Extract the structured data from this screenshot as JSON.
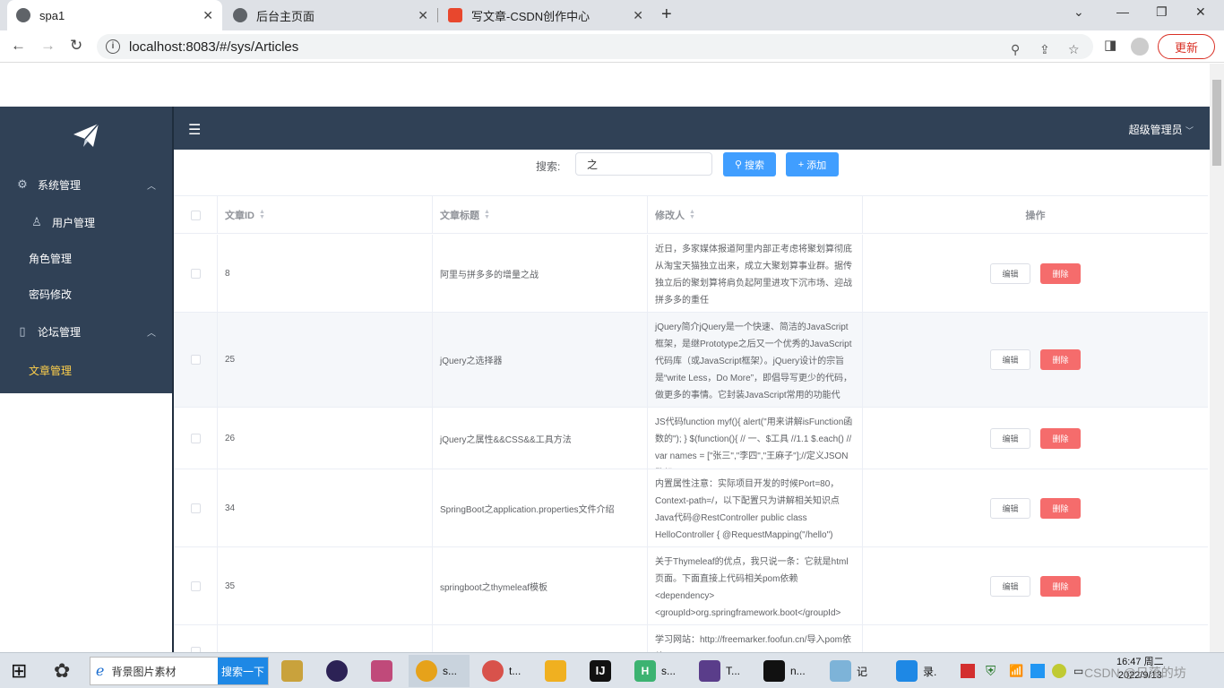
{
  "browser": {
    "tabs": [
      {
        "title": "spa1",
        "active": true
      },
      {
        "title": "后台主页面",
        "active": false
      },
      {
        "title": "写文章-CSDN创作中心",
        "active": false
      }
    ],
    "url": "localhost:8083/#/sys/Articles",
    "update_label": "更新"
  },
  "sidebar": {
    "items": [
      {
        "label": "系统管理",
        "icon": "gear-icon"
      },
      {
        "label": "用户管理",
        "icon": "user-icon"
      },
      {
        "label": "角色管理"
      },
      {
        "label": "密码修改"
      },
      {
        "label": "论坛管理",
        "icon": "book-icon"
      },
      {
        "label": "文章管理",
        "active": true
      }
    ]
  },
  "header": {
    "user": "超级管理员"
  },
  "search": {
    "label": "搜索:",
    "value": "之",
    "search_btn": "搜索",
    "add_btn": "添加"
  },
  "table": {
    "columns": [
      "文章ID",
      "文章标题",
      "修改人",
      "操作"
    ],
    "edit_label": "编辑",
    "delete_label": "删除",
    "rows": [
      {
        "id": "8",
        "title": "阿里与拼多多的增量之战",
        "content": "近日，多家媒体报道阿里内部正考虑将聚划算彻底从淘宝天猫独立出来，成立大聚划算事业群。据传独立后的聚划算将肩负起阿里进攻下沉市场、迎战拼多多的重任"
      },
      {
        "id": "25",
        "title": "jQuery之选择器",
        "content": "jQuery简介jQuery是一个快速、简洁的JavaScript框架，是继Prototype之后又一个优秀的JavaScript代码库（或JavaScript框架）。jQuery设计的宗旨是“write Less，Do More”，即倡导写更少的代码，做更多的事情。它封装JavaScript常用的功能代码，"
      },
      {
        "id": "26",
        "title": "jQuery之属性&&CSS&&工具方法",
        "content": "JS代码function myf(){ alert(\"用来讲解isFunction函数的\"); } $(function(){ // 一、$工具 //1.1 $.each() // var names = [\"张三\",\"李四\",\"王麻子\"];//定义JSON数组 ["
      },
      {
        "id": "34",
        "title": "SpringBoot之application.properties文件介绍",
        "content": "内置属性注意：实际项目开发的时候Port=80，Context-path=/，以下配置只为讲解相关知识点Java代码@RestController public class HelloController { @RequestMapping(\"/hello\") public String he"
      },
      {
        "id": "35",
        "title": "springboot之thymeleaf模板",
        "content": "关于Thymeleaf的优点，我只说一条：它就是html页面。下面直接上代码相关pom依赖<dependency> <groupId>org.springframework.boot</groupId> <artifactId>spring-boot-start"
      },
      {
        "id": "",
        "title": "",
        "content": "学习网站：http://freemarker.foofun.cn/导入pom依赖"
      }
    ]
  },
  "taskbar": {
    "search_text": "背景图片素材",
    "search_btn": "搜索一下",
    "apps": [
      "s...",
      "t...",
      "s...",
      "T...",
      "n...",
      "记",
      "录."
    ],
    "time": "16:47 周二",
    "date": "2022/9/13",
    "watermark": "CSDN @日落的坊"
  }
}
